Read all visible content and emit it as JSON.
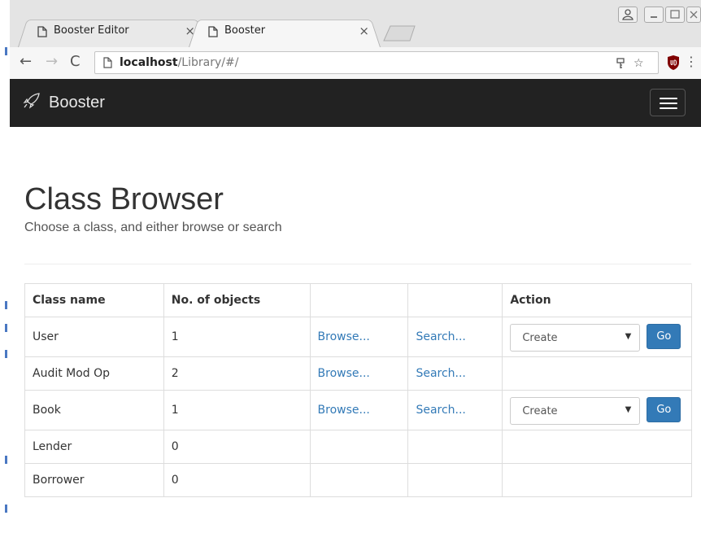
{
  "browser": {
    "tabs": [
      {
        "title": "Booster Editor",
        "close": "×",
        "active": false
      },
      {
        "title": "Booster",
        "close": "×",
        "active": true
      }
    ],
    "url_host": "localhost",
    "url_path": "/Library/#/"
  },
  "navbar": {
    "brand": "Booster"
  },
  "header": {
    "title": "Class Browser",
    "subtitle": "Choose a class, and either browse or search"
  },
  "table": {
    "columns": [
      "Class name",
      "No. of objects",
      "",
      "",
      "Action"
    ],
    "rows": [
      {
        "name": "User",
        "count": "1",
        "browse": "Browse...",
        "search": "Search...",
        "action": "Create",
        "go": "Go"
      },
      {
        "name": "Audit Mod Op",
        "count": "2",
        "browse": "Browse...",
        "search": "Search..."
      },
      {
        "name": "Book",
        "count": "1",
        "browse": "Browse...",
        "search": "Search...",
        "action": "Create",
        "go": "Go"
      },
      {
        "name": "Lender",
        "count": "0"
      },
      {
        "name": "Borrower",
        "count": "0"
      }
    ]
  },
  "colors": {
    "navbar_bg": "#222222",
    "link": "#337ab7",
    "primary_button": "#337ab7"
  }
}
